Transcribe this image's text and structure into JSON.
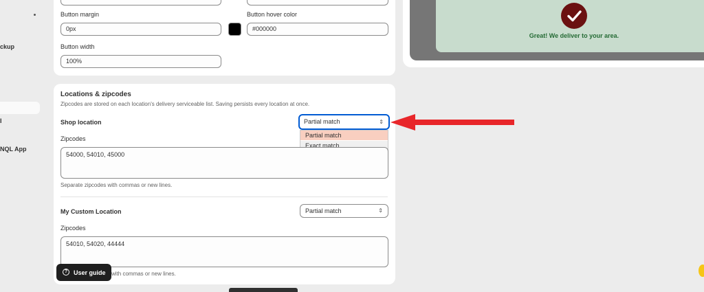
{
  "sidebar": {
    "items": [
      {
        "label": "ckup"
      },
      {
        "label": "I"
      },
      {
        "label": "NQL App"
      }
    ]
  },
  "button_settings": {
    "button_margin_label": "Button margin",
    "button_margin_value": "0px",
    "button_hover_color_label": "Button hover color",
    "button_hover_color_value": "#000000",
    "hover_swatch_color": "#000000",
    "button_width_label": "Button width",
    "button_width_value": "100%"
  },
  "locations": {
    "title": "Locations & zipcodes",
    "description": "Zipcodes are stored on each location's delivery serviceable list. Saving persists every location at once.",
    "zipcodes_label": "Zipcodes",
    "help_text": "Separate zipcodes with commas or new lines.",
    "help_text_partial": "with commas or new lines.",
    "items": [
      {
        "name": "Shop location",
        "match": "Partial match",
        "zipcodes": "54000, 54010, 45000"
      },
      {
        "name": "My Custom Location",
        "match": "Partial match",
        "zipcodes": "54010, 54020, 44444"
      }
    ],
    "match_options": [
      "Partial match",
      "Exact match"
    ]
  },
  "preview": {
    "message": "Great! We deliver to your area.",
    "success_color": "#256b35",
    "check_color": "#6b1111"
  },
  "guide": {
    "label": "User guide",
    "icon": "question-circle-icon"
  },
  "colors": {
    "accent_focus": "#005bd3",
    "arrow": "#e8262a"
  }
}
